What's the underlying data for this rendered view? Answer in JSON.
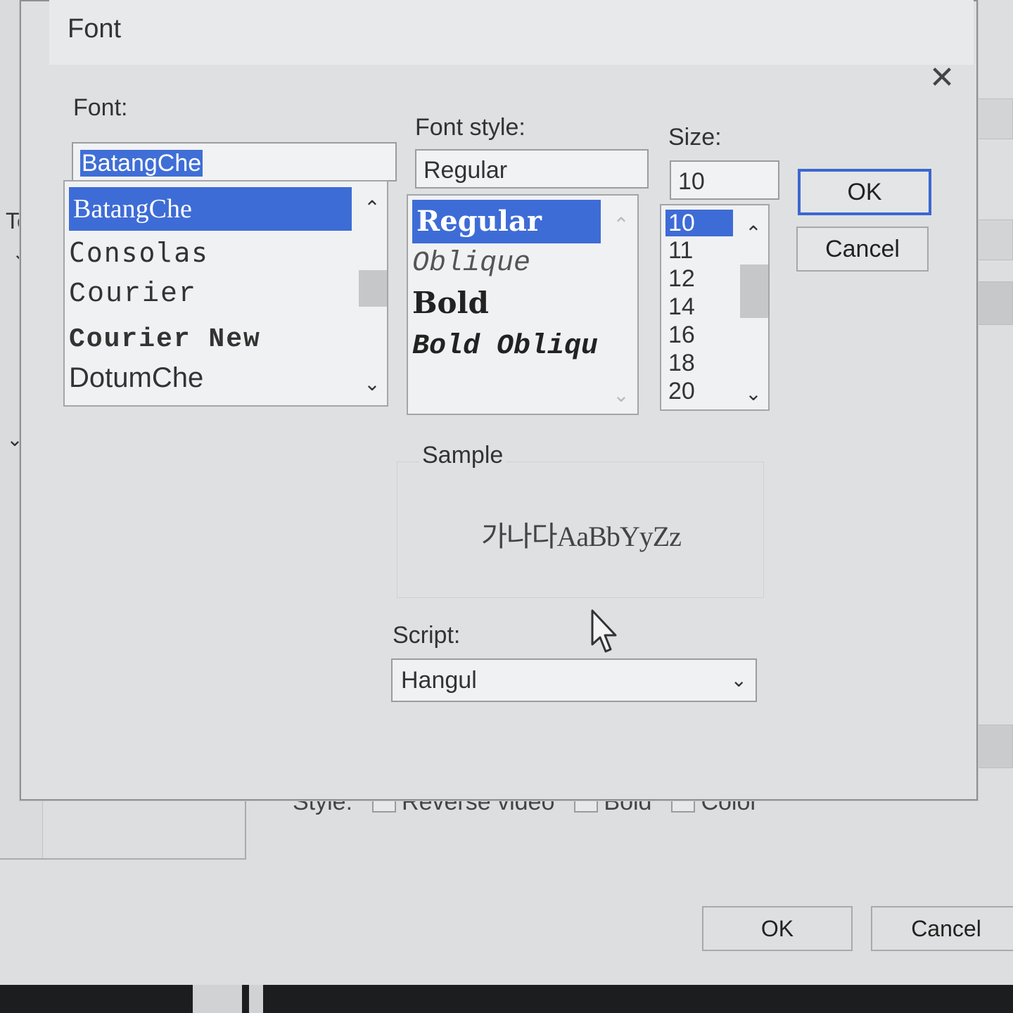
{
  "background": {
    "partial_label": "Ter",
    "style_row": {
      "label": "Style:",
      "options": [
        "Reverse video",
        "Bold",
        "Color"
      ]
    },
    "buttons": {
      "ok": "OK",
      "cancel": "Cancel"
    }
  },
  "dialog": {
    "title": "Font",
    "close_glyph": "✕",
    "font": {
      "label": "Font:",
      "value": "BatangChe",
      "items": [
        "BatangChe",
        "Consolas",
        "Courier",
        "Courier New",
        "DotumChe"
      ],
      "selected": "BatangChe"
    },
    "font_style": {
      "label": "Font style:",
      "value": "Regular",
      "items": [
        "Regular",
        "Oblique",
        "Bold",
        "Bold Obliqu"
      ],
      "selected": "Regular"
    },
    "size": {
      "label": "Size:",
      "value": "10",
      "items": [
        "10",
        "11",
        "12",
        "14",
        "16",
        "18",
        "20"
      ],
      "selected": "10"
    },
    "buttons": {
      "ok": "OK",
      "cancel": "Cancel"
    },
    "sample": {
      "label": "Sample",
      "text": "가나다AaBbYyZz"
    },
    "script": {
      "label": "Script:",
      "value": "Hangul"
    }
  },
  "icons": {
    "chevron_down": "⌄",
    "chevron_up": "⌃",
    "scroll_up": "⌃",
    "scroll_down": "⌄"
  }
}
